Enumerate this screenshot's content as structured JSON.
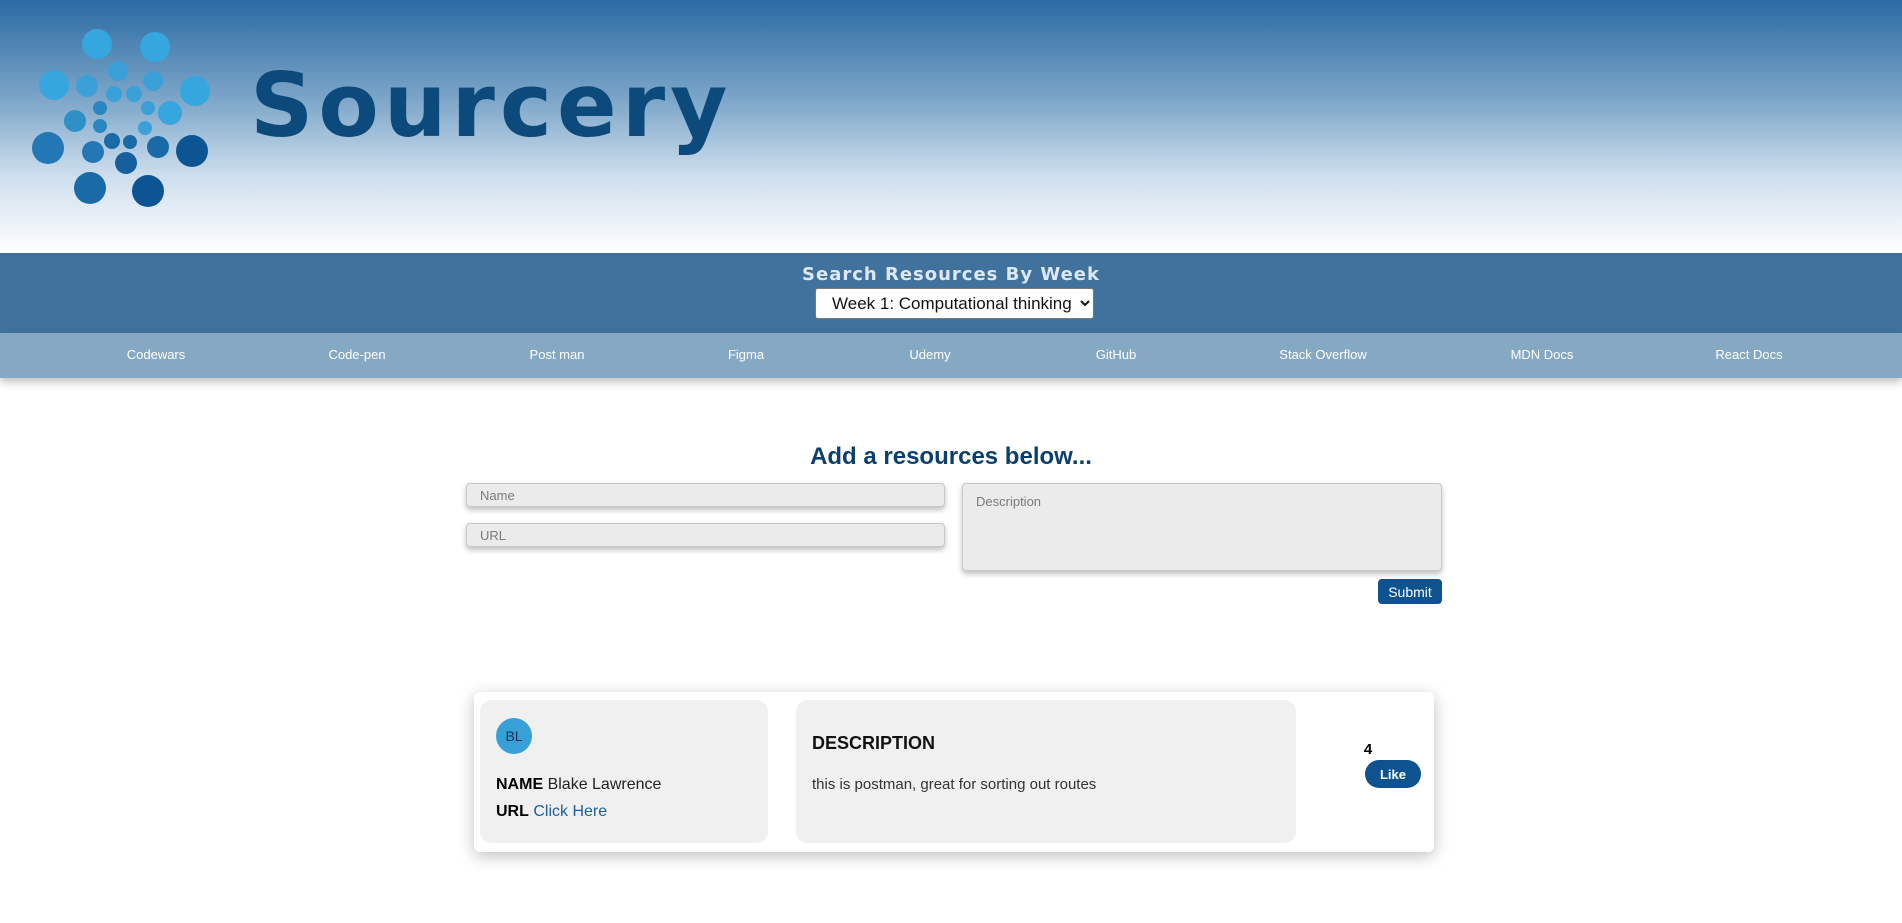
{
  "header": {
    "logo_text": "Sourcery",
    "logo_icon": "dot-cluster-logo-icon",
    "colors": {
      "brand_dark": "#0d4a7c",
      "brand_light": "#37a0d6"
    }
  },
  "week_search": {
    "title": "Search Resources By Week",
    "selected": "Week 1: Computational thinking"
  },
  "nav": {
    "items": [
      {
        "label": "Codewars"
      },
      {
        "label": "Code-pen"
      },
      {
        "label": "Post man"
      },
      {
        "label": "Figma"
      },
      {
        "label": "Udemy"
      },
      {
        "label": "GitHub"
      },
      {
        "label": "Stack Overflow"
      },
      {
        "label": "MDN Docs"
      },
      {
        "label": "React Docs"
      }
    ]
  },
  "form": {
    "title": "Add a resources below...",
    "name_placeholder": "Name",
    "url_placeholder": "URL",
    "description_placeholder": "Description",
    "submit_label": "Submit"
  },
  "resources": [
    {
      "initials": "BL",
      "name_label": "NAME",
      "name": "Blake Lawrence",
      "url_label": "URL",
      "url_text": "Click Here",
      "description_title": "DESCRIPTION",
      "description": "this is postman, great for sorting out routes",
      "likes": "4",
      "like_label": "Like"
    }
  ]
}
